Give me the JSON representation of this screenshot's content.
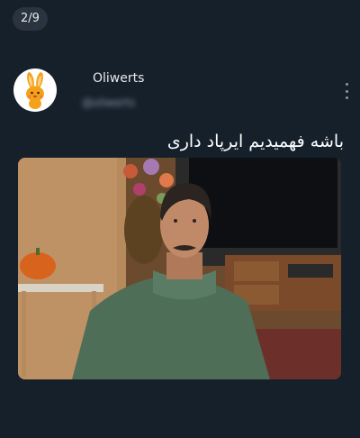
{
  "viewer": {
    "counter": "2/9"
  },
  "post": {
    "author_name": "Oliwerts",
    "author_handle": "@oliwerts",
    "text": "باشه فهمیدیم ایرپاد داری",
    "avatar_icon": "bunny-icon",
    "media_alt": "man-in-green-sweater-photo"
  },
  "colors": {
    "background": "#15202b",
    "counter_bg": "#2a3440",
    "muted": "#8b98a5"
  }
}
